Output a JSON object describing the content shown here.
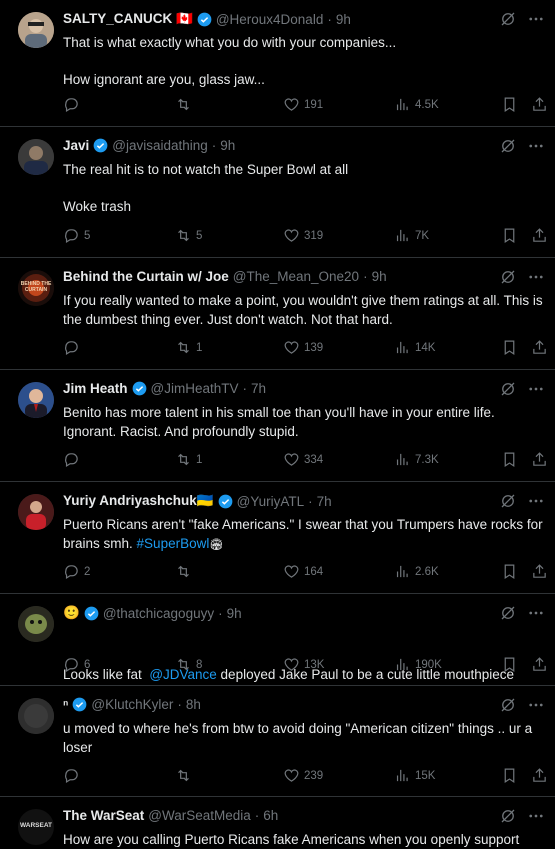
{
  "tweets": [
    {
      "name": "SALTY_CANUCK 🇨🇦",
      "handle": "@Heroux4Donald",
      "time": "9h",
      "lines": [
        "That is what exactly what you do with your companies...",
        "",
        "How ignorant are you, glass jaw..."
      ],
      "replies": "",
      "reposts": "",
      "likes": "191",
      "views": "4.5K"
    },
    {
      "name": "Javi",
      "handle": "@javisaidathing",
      "time": "9h",
      "lines": [
        "The real hit is to not watch the Super Bowl at all",
        "",
        "Woke trash"
      ],
      "replies": "5",
      "reposts": "5",
      "likes": "319",
      "views": "7K"
    },
    {
      "name": "Behind the Curtain w/ Joe",
      "handle": "@The_Mean_One20",
      "time": "9h",
      "avatar_text": "BEHIND THE CURTAIN",
      "lines": [
        "If you really wanted to make a point, you wouldn't give them ratings at all. This is the dumbest thing ever. Just don't watch. Not that hard."
      ],
      "replies": "",
      "reposts": "1",
      "likes": "139",
      "views": "14K"
    },
    {
      "name": "Jim Heath",
      "handle": "@JimHeathTV",
      "time": "7h",
      "lines": [
        "Benito has more talent in his small toe than you'll have in your entire life. Ignorant. Racist. And profoundly stupid."
      ],
      "replies": "",
      "reposts": "1",
      "likes": "334",
      "views": "7.3K"
    },
    {
      "name": "Yuriy Andriyashchuk🇺🇦",
      "handle": "@YuriyATL",
      "time": "7h",
      "lines": [
        "Puerto Ricans aren't \"fake Americans.\" I swear that you Trumpers have rocks for brains smh."
      ],
      "hashtag": "#SuperBowl",
      "replies": "2",
      "reposts": "",
      "likes": "164",
      "views": "2.6K"
    },
    {
      "name": "🙂",
      "handle": "@thatchicagoguyy",
      "time": "9h",
      "text_before": "Looks like fat ",
      "mention": "@JDVance",
      "text_after": " deployed Jake Paul to be a cute little mouthpiece",
      "replies": "6",
      "reposts": "8",
      "likes": "13K",
      "views": "190K"
    },
    {
      "name": "ⁿ",
      "handle": "@KlutchKyler",
      "time": "8h",
      "lines": [
        "u moved to where he's from btw to avoid doing \"American citizen\" things .. ur a loser"
      ],
      "replies": "",
      "reposts": "",
      "likes": "239",
      "views": "15K"
    },
    {
      "name": "The WarSeat",
      "handle": "@WarSeatMedia",
      "time": "6h",
      "avatar_text": "WARSEAT",
      "lines": [
        "How are you calling Puerto Ricans fake Americans when you openly support"
      ]
    }
  ]
}
